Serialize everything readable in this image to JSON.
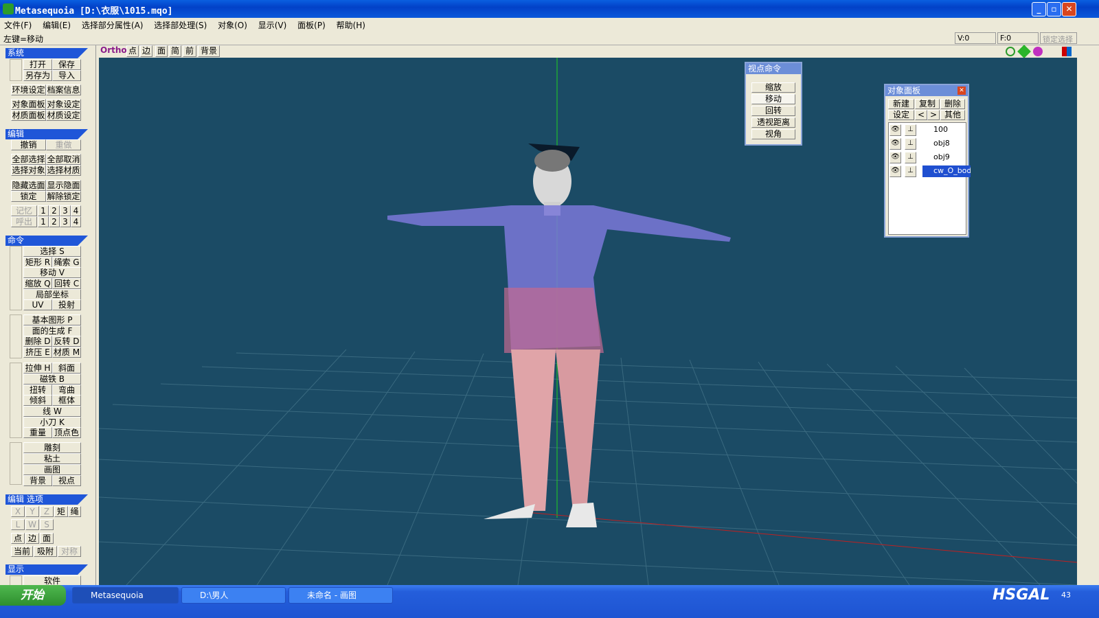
{
  "window": {
    "title": "Metasequoia [D:\\衣服\\1015.mqo]",
    "min": "_",
    "max": "▫",
    "close": "✕"
  },
  "menu": [
    "文件(F)",
    "编辑(E)",
    "选择部分属性(A)",
    "选择部处理(S)",
    "对象(O)",
    "显示(V)",
    "面板(P)",
    "帮助(H)"
  ],
  "status": {
    "left": "左键=移动",
    "v": "V:0",
    "f": "F:0",
    "lock": "锁定选择"
  },
  "left": {
    "system": {
      "title": "系统",
      "open": "打开",
      "save": "保存",
      "saveas": "另存为",
      "import": "导入",
      "env": "环境设定",
      "info": "档案信息",
      "objpanel": "对象面板",
      "objset": "对象设定",
      "matpanel": "材质面板",
      "matset": "材质设定"
    },
    "edit": {
      "title": "编辑",
      "undo": "撤销",
      "redo": "重做",
      "selall": "全部选择",
      "desel": "全部取消",
      "selobj": "选择对象",
      "selmat": "选择材质",
      "hide": "隐藏选面",
      "show": "显示隐面",
      "lock": "锁定",
      "unlock": "解除锁定",
      "mem": "记忆",
      "recall": "呼出",
      "n1": "1",
      "n2": "2",
      "n3": "3",
      "n4": "4"
    },
    "cmd": {
      "title": "命令",
      "select": "选择 S",
      "rect": "矩形 R",
      "lasso": "绳索 G",
      "move": "移动 V",
      "scale": "缩放 Q",
      "rotate": "回转 C",
      "local": "局部坐标",
      "uv": "UV",
      "project": "投射",
      "basic": "基本图形 P",
      "face": "面的生成 F",
      "delete": "删除 D",
      "flip": "反转 D",
      "extrude": "挤压 E",
      "material": "材质 M",
      "stretch": "拉伸 H",
      "bevel": "斜面",
      "magnet": "磁铁 B",
      "twist": "扭转",
      "bend": "弯曲",
      "shear": "倾斜",
      "lattice": "框体",
      "line": "线 W",
      "knife": "小刀 K",
      "weld": "重量",
      "vcolor": "顶点色",
      "sculpt": "雕刻",
      "clay": "粘土",
      "paint": "画图",
      "bg": "背景",
      "view": "视点"
    },
    "opt": {
      "title": "编辑 选项",
      "x": "X",
      "y": "Y",
      "z": "Z",
      "rect": "矩",
      "lasso": "绳",
      "l": "L",
      "w": "W",
      "s": "S",
      "pt": "点",
      "edge": "边",
      "face": "面",
      "cur": "当前",
      "snap": "吸附",
      "sym": "对称"
    },
    "disp": {
      "title": "显示",
      "soft": "软件"
    }
  },
  "viewtb": {
    "ortho": "Ortho",
    "pt": "点",
    "edge": "边",
    "face": "面",
    "simple": "简",
    "front": "前",
    "bg": "背景"
  },
  "viewcmd": {
    "title": "视点命令",
    "zoom": "缩放",
    "move": "移动",
    "rotate": "回转",
    "persp": "透视距离",
    "angle": "视角"
  },
  "objpanel": {
    "title": "对象面板",
    "new": "新建",
    "copy": "复制",
    "del": "删除",
    "set": "设定",
    "prev": "<",
    "next": ">",
    "other": "其他",
    "objects": [
      {
        "name": "100",
        "sel": false
      },
      {
        "name": "obj8",
        "sel": false
      },
      {
        "name": "obj9",
        "sel": false
      },
      {
        "name": "cw_O_bod",
        "sel": true
      }
    ]
  },
  "taskbar": {
    "start": "开始",
    "t1": "Metasequoia",
    "t2": "D:\\男人",
    "t3": "未命名 - 画图",
    "wm": "HSGAL",
    "time": "43"
  }
}
